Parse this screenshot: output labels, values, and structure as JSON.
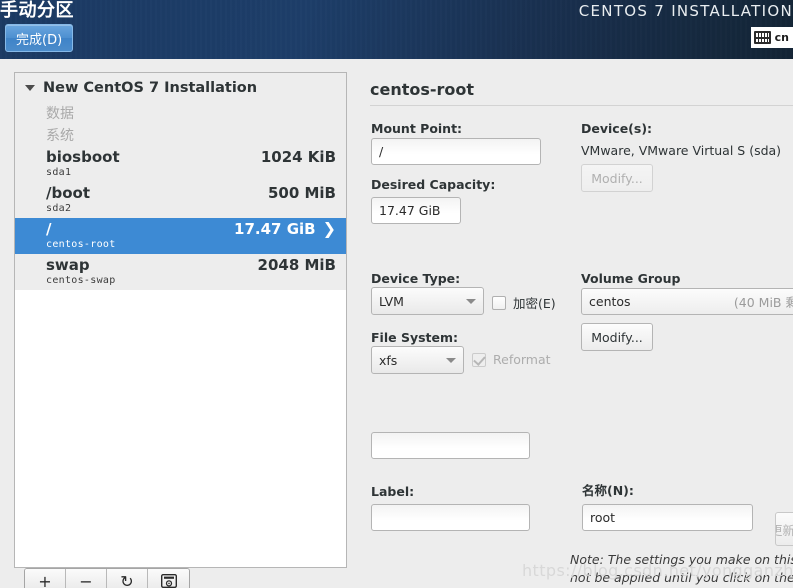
{
  "header": {
    "title": "手动分区",
    "done_label": "完成(D)",
    "product": "CENTOS 7 INSTALLATION",
    "keyboard_layout": "cn",
    "keyboard_icon": "keyboard-icon",
    "accent_color": "#4d8fd0",
    "background_color": "#1b3a63"
  },
  "left_panel": {
    "group_title": "New CentOS 7 Installation",
    "sections": [
      {
        "label": "数据"
      },
      {
        "label": "系统"
      }
    ],
    "partitions": [
      {
        "name": "biosboot",
        "size": "1024 KiB",
        "device": "sda1",
        "selected": false
      },
      {
        "name": "/boot",
        "size": "500 MiB",
        "device": "sda2",
        "selected": false
      },
      {
        "name": "/",
        "size": "17.47 GiB",
        "device": "centos-root",
        "selected": true
      },
      {
        "name": "swap",
        "size": "2048 MiB",
        "device": "centos-swap",
        "selected": false
      }
    ],
    "selected_highlight_color": "#3d8ad4",
    "toolbar": [
      {
        "icon": "plus-icon",
        "label": "+"
      },
      {
        "icon": "minus-icon",
        "label": "−"
      },
      {
        "icon": "refresh-icon",
        "label": "↻"
      },
      {
        "icon": "disk-summary-icon",
        "label": ""
      }
    ]
  },
  "detail": {
    "title": "centos-root",
    "mount_point_label": "Mount Point:",
    "mount_point_value": "/",
    "desired_capacity_label": "Desired Capacity:",
    "desired_capacity_value": "17.47 GiB",
    "devices_label": "Device(s):",
    "devices_value": "VMware, VMware Virtual S (sda)",
    "devices_modify_label": "Modify...",
    "device_type_label": "Device Type:",
    "device_type_value": "LVM",
    "encrypt_label": "加密(E)",
    "encrypt_checked": false,
    "volume_group_label": "Volume Group",
    "volume_group_value": "centos",
    "volume_group_free": "(40 MiB 剩",
    "volume_group_modify_label": "Modify...",
    "file_system_label": "File System:",
    "file_system_value": "xfs",
    "reformat_label": "Reformat",
    "reformat_checked": true,
    "label_label": "Label:",
    "label_value": "",
    "name_label": "名称(N):",
    "name_value": "root",
    "update_settings_label": "更新设置",
    "note_text": "Note:  The settings you make on this screen will not be applied until you click on the",
    "watermark": "https://blog.csdn.net/yongganzhe02"
  }
}
